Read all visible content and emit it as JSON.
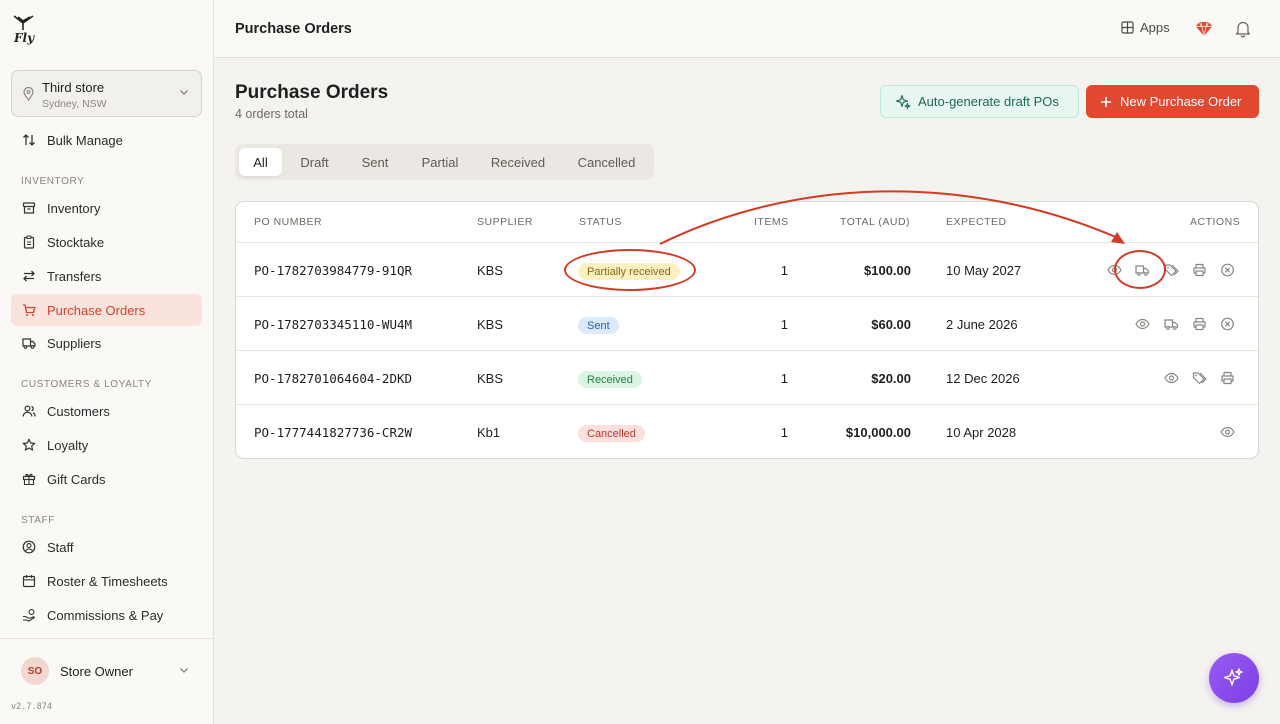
{
  "app": {
    "logo_text": "Fly",
    "version": "v2.7.874"
  },
  "store": {
    "name": "Third store",
    "location": "Sydney, NSW"
  },
  "sidebar": {
    "bulk_manage": "Bulk Manage",
    "sections": {
      "inventory": "INVENTORY",
      "customers": "CUSTOMERS & LOYALTY",
      "staff": "STAFF"
    },
    "items": {
      "inventory": "Inventory",
      "stocktake": "Stocktake",
      "transfers": "Transfers",
      "purchase_orders": "Purchase Orders",
      "suppliers": "Suppliers",
      "customers": "Customers",
      "loyalty": "Loyalty",
      "gift_cards": "Gift Cards",
      "staff": "Staff",
      "roster": "Roster & Timesheets",
      "commissions": "Commissions & Pay"
    },
    "user": {
      "initials": "SO",
      "name": "Store Owner"
    }
  },
  "header": {
    "title": "Purchase Orders",
    "apps_label": "Apps"
  },
  "main": {
    "title": "Purchase Orders",
    "subtitle": "4 orders total",
    "auto_button": "Auto-generate draft POs",
    "new_button": "New Purchase Order",
    "tabs": [
      "All",
      "Draft",
      "Sent",
      "Partial",
      "Received",
      "Cancelled"
    ],
    "active_tab": "All",
    "columns": {
      "po": "PO NUMBER",
      "supplier": "SUPPLIER",
      "status": "STATUS",
      "items": "ITEMS",
      "total": "TOTAL (AUD)",
      "expected": "EXPECTED",
      "actions": "ACTIONS"
    },
    "rows": [
      {
        "po": "PO-1782703984779-91QR",
        "supplier": "KBS",
        "status": "Partially received",
        "items": "1",
        "total": "$100.00",
        "expected": "10 May 2027",
        "actions": [
          "view",
          "receive",
          "tags",
          "print",
          "cancel"
        ]
      },
      {
        "po": "PO-1782703345110-WU4M",
        "supplier": "KBS",
        "status": "Sent",
        "items": "1",
        "total": "$60.00",
        "expected": "2 June 2026",
        "actions": [
          "view",
          "receive",
          "print",
          "cancel"
        ]
      },
      {
        "po": "PO-1782701064604-2DKD",
        "supplier": "KBS",
        "status": "Received",
        "items": "1",
        "total": "$20.00",
        "expected": "12 Dec 2026",
        "actions": [
          "view",
          "tags",
          "print"
        ]
      },
      {
        "po": "PO-1777441827736-CR2W",
        "supplier": "Kb1",
        "status": "Cancelled",
        "items": "1",
        "total": "$10,000.00",
        "expected": "10 Apr 2028",
        "actions": [
          "view"
        ]
      }
    ]
  },
  "colors": {
    "accent": "#e2472f",
    "status_partial_bg": "#fbf0c2",
    "status_partial_fg": "#8a6a10",
    "status_sent_bg": "#dbeafc",
    "status_sent_fg": "#2b62b5",
    "status_received_bg": "#dcf4e4",
    "status_received_fg": "#23804a",
    "status_cancelled_bg": "#fbe0dd",
    "status_cancelled_fg": "#b23a2c",
    "annotation": "#d23b24"
  },
  "icons": {
    "view": "eye-icon",
    "receive": "truck-icon",
    "tags": "tags-icon",
    "print": "printer-icon",
    "cancel": "x-circle-icon",
    "fab": "sparkles-icon",
    "gem": "gem-icon",
    "bell": "bell-icon",
    "apps": "grid-icon"
  }
}
